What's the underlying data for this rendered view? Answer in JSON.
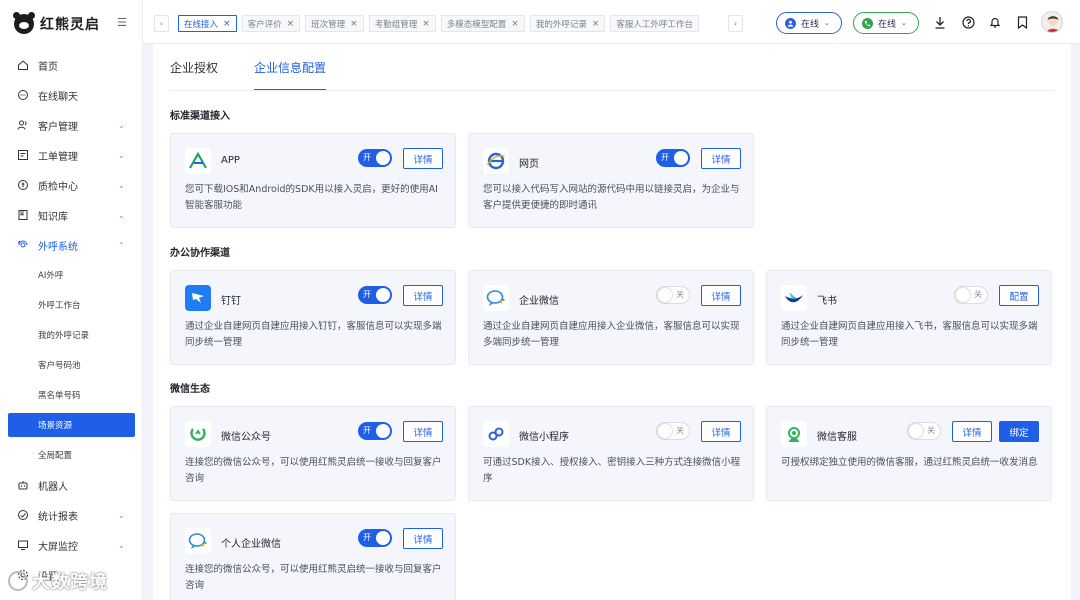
{
  "brand": {
    "name": "红熊灵启"
  },
  "sidebar": {
    "items": [
      {
        "label": "首页",
        "icon": "home-icon"
      },
      {
        "label": "在线聊天",
        "icon": "chat-icon"
      },
      {
        "label": "客户管理",
        "icon": "users-icon",
        "expandable": true
      },
      {
        "label": "工单管理",
        "icon": "ticket-icon",
        "expandable": true
      },
      {
        "label": "质检中心",
        "icon": "quality-icon",
        "expandable": true
      },
      {
        "label": "知识库",
        "icon": "book-icon",
        "expandable": true
      },
      {
        "label": "外呼系统",
        "icon": "outbound-icon",
        "expandable": true,
        "open": true
      },
      {
        "label": "机器人",
        "icon": "robot-icon"
      },
      {
        "label": "统计报表",
        "icon": "report-icon",
        "expandable": true
      },
      {
        "label": "大屏监控",
        "icon": "monitor-icon",
        "expandable": true
      },
      {
        "label": "设置",
        "icon": "settings-icon"
      }
    ],
    "sub_items": [
      "AI外呼",
      "外呼工作台",
      "我的外呼记录",
      "客户号码池",
      "黑名单号码",
      "场景资源",
      "全局配置"
    ],
    "active_sub": "场景资源"
  },
  "topbar": {
    "tabs": [
      {
        "label": "在线接入",
        "active": true
      },
      {
        "label": "客户评价"
      },
      {
        "label": "班次管理"
      },
      {
        "label": "考勤组管理"
      },
      {
        "label": "多模态模型配置"
      },
      {
        "label": "我的外呼记录"
      },
      {
        "label": "客服人工外呼工作台"
      }
    ],
    "status_1": "在线",
    "status_2": "在线"
  },
  "page": {
    "tabs": [
      "企业授权",
      "企业信息配置"
    ],
    "active_tab": "企业信息配置"
  },
  "sections": [
    {
      "title": "标准渠道接入",
      "cards": [
        {
          "name": "APP",
          "icon": "app-icon",
          "switch": "开",
          "switch_on": true,
          "buttons": [
            "详情"
          ],
          "desc": "您可下载IOS和Android的SDK用以接入灵启，更好的使用AI智能客服功能"
        },
        {
          "name": "网页",
          "icon": "web-icon",
          "switch": "开",
          "switch_on": true,
          "buttons": [
            "详情"
          ],
          "desc": "您可以接入代码写入网站的源代码中用以链接灵启，为企业与客户提供更便捷的即时通讯"
        }
      ]
    },
    {
      "title": "办公协作渠道",
      "cards": [
        {
          "name": "钉钉",
          "icon": "dingtalk-icon",
          "switch": "开",
          "switch_on": true,
          "buttons": [
            "详情"
          ],
          "desc": "通过企业自建网页自建应用接入钉钉，客服信息可以实现多端同步统一管理"
        },
        {
          "name": "企业微信",
          "icon": "wecom-icon",
          "switch": "关",
          "switch_on": false,
          "buttons": [
            "详情"
          ],
          "desc": "通过企业自建网页自建应用接入企业微信，客服信息可以实现多端同步统一管理"
        },
        {
          "name": "飞书",
          "icon": "feishu-icon",
          "switch": "关",
          "switch_on": false,
          "buttons": [
            "配置"
          ],
          "desc": "通过企业自建网页自建应用接入飞书，客服信息可以实现多端同步统一管理"
        }
      ]
    },
    {
      "title": "微信生态",
      "cards": [
        {
          "name": "微信公众号",
          "icon": "wechat-official-icon",
          "switch": "开",
          "switch_on": true,
          "buttons": [
            "详情"
          ],
          "desc": "连接您的微信公众号，可以使用红熊灵启统一接收与回复客户咨询"
        },
        {
          "name": "微信小程序",
          "icon": "miniprogram-icon",
          "switch": "关",
          "switch_on": false,
          "buttons": [
            "详情"
          ],
          "desc": "可通过SDK接入、授权接入、密钥接入三种方式连接微信小程序"
        },
        {
          "name": "微信客服",
          "icon": "wechat-service-icon",
          "switch": "关",
          "switch_on": false,
          "buttons": [
            "详情",
            "绑定"
          ],
          "desc": "可授权绑定独立使用的微信客服，通过红熊灵启统一收发消息"
        },
        {
          "name": "个人企业微信",
          "icon": "personal-wecom-icon",
          "switch": "开",
          "switch_on": true,
          "buttons": [
            "详情"
          ],
          "desc": "连接您的微信公众号，可以使用红熊灵启统一接收与回复客户咨询"
        }
      ]
    }
  ],
  "watermark": "大数跨境",
  "colors": {
    "accent": "#1f5ee6",
    "online_blue": "#2d62d8",
    "online_green": "#2fa64a"
  }
}
